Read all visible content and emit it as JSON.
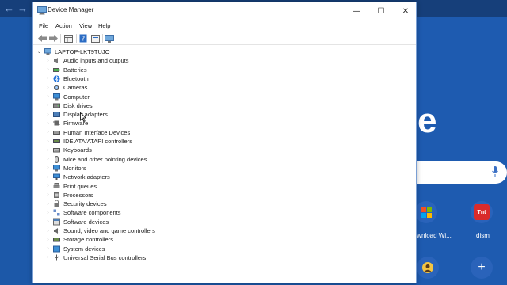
{
  "window": {
    "title": "Device Manager",
    "controls": {
      "minimize": "—",
      "maximize": "☐",
      "close": "✕"
    }
  },
  "menu": [
    "File",
    "Action",
    "View",
    "Help"
  ],
  "toolbar": [
    "back-icon",
    "forward-icon",
    "properties-grid-icon",
    "help-icon",
    "driver-list-icon",
    "monitor-icon"
  ],
  "tree": {
    "root": "LAPTOP-LKT9TUJO",
    "items": [
      {
        "label": "Audio inputs and outputs",
        "icon": "speaker-icon"
      },
      {
        "label": "Batteries",
        "icon": "battery-icon"
      },
      {
        "label": "Bluetooth",
        "icon": "bluetooth-icon"
      },
      {
        "label": "Cameras",
        "icon": "camera-icon"
      },
      {
        "label": "Computer",
        "icon": "computer-icon"
      },
      {
        "label": "Disk drives",
        "icon": "disk-icon"
      },
      {
        "label": "Display adapters",
        "icon": "display-adapter-icon"
      },
      {
        "label": "Firmware",
        "icon": "chip-icon"
      },
      {
        "label": "Human Interface Devices",
        "icon": "hid-icon"
      },
      {
        "label": "IDE ATA/ATAPI controllers",
        "icon": "ide-icon"
      },
      {
        "label": "Keyboards",
        "icon": "keyboard-icon"
      },
      {
        "label": "Mice and other pointing devices",
        "icon": "mouse-icon"
      },
      {
        "label": "Monitors",
        "icon": "monitor-icon"
      },
      {
        "label": "Network adapters",
        "icon": "network-icon"
      },
      {
        "label": "Print queues",
        "icon": "printer-icon"
      },
      {
        "label": "Processors",
        "icon": "processor-icon"
      },
      {
        "label": "Security devices",
        "icon": "security-icon"
      },
      {
        "label": "Software components",
        "icon": "component-icon"
      },
      {
        "label": "Software devices",
        "icon": "software-device-icon"
      },
      {
        "label": "Sound, video and game controllers",
        "icon": "sound-icon"
      },
      {
        "label": "Storage controllers",
        "icon": "storage-icon"
      },
      {
        "label": "System devices",
        "icon": "system-icon"
      },
      {
        "label": "Universal Serial Bus controllers",
        "icon": "usb-icon"
      }
    ]
  },
  "background": {
    "logo_letter": "e",
    "tiles": [
      {
        "label": "lownload Wi...",
        "icon": "microsoft-logo-icon"
      },
      {
        "label": "dism",
        "icon_text": "Tnt"
      }
    ]
  },
  "colors": {
    "desktop": "#1c58a8",
    "accent": "#0078d7",
    "window_border": "#7a9fd4"
  }
}
